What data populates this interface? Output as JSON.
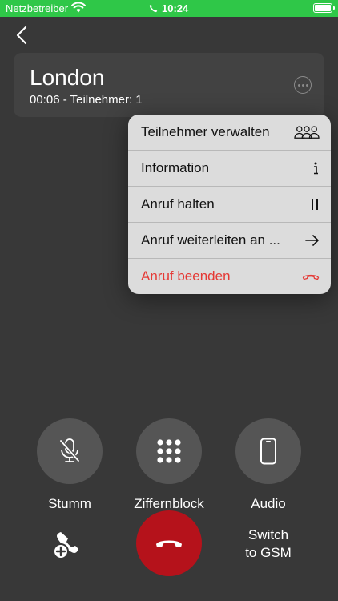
{
  "status_bar": {
    "carrier": "Netzbetreiber",
    "time": "10:24",
    "background": "#2fc748"
  },
  "call": {
    "title": "London",
    "subtitle": "00:06 - Teilnehmer: 1"
  },
  "menu": {
    "items": [
      {
        "label": "Teilnehmer verwalten",
        "icon": "participants-icon"
      },
      {
        "label": "Information",
        "icon": "info-icon"
      },
      {
        "label": "Anruf halten",
        "icon": "pause-icon"
      },
      {
        "label": "Anruf weiterleiten an ...",
        "icon": "arrow-right-icon"
      },
      {
        "label": "Anruf beenden",
        "icon": "hangup-icon",
        "color": "#e53935"
      }
    ]
  },
  "controls": {
    "mute_label": "Stumm",
    "keypad_label": "Ziffernblock",
    "audio_label": "Audio",
    "switch_line1": "Switch",
    "switch_line2": "to GSM"
  },
  "colors": {
    "background": "#383838",
    "hangup": "#b5121b",
    "danger": "#e53935"
  }
}
